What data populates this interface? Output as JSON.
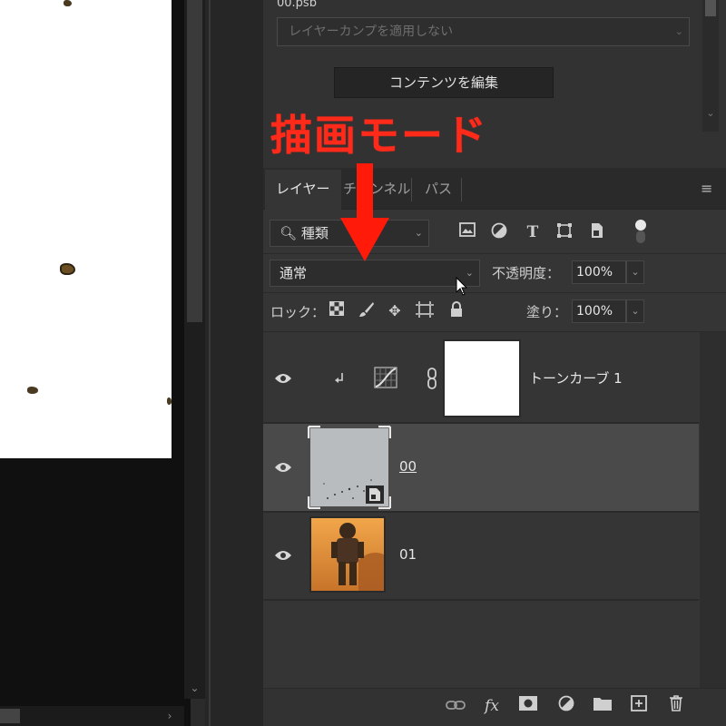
{
  "properties": {
    "filename": "00.psb",
    "layer_comp_placeholder": "レイヤーカンプを適用しない",
    "edit_contents_label": "コンテンツを編集"
  },
  "annotation": {
    "label": "描画モード",
    "color": "#ff2a1a"
  },
  "layers_panel": {
    "tabs": [
      {
        "label": "レイヤー",
        "active": true
      },
      {
        "label": "チャンネル",
        "active": false
      },
      {
        "label": "パス",
        "active": false
      }
    ],
    "filter_value": "種類",
    "filter_icons": [
      "image-filter-icon",
      "adjustment-filter-icon",
      "type-filter-icon",
      "shape-filter-icon",
      "smart-object-filter-icon"
    ],
    "blend_mode": "通常",
    "opacity_label": "不透明度：",
    "opacity_value": "100%",
    "lock_label": "ロック：",
    "fill_label": "塗り：",
    "fill_value": "100%",
    "layers": [
      {
        "name": "トーンカーブ 1",
        "visible": true,
        "type": "adjustment",
        "clipped": true
      },
      {
        "name": "00",
        "visible": true,
        "type": "smart-object",
        "selected": true
      },
      {
        "name": "01",
        "visible": true,
        "type": "image"
      }
    ],
    "bottom_icons": [
      "link-layers-icon",
      "fx-icon",
      "add-mask-icon",
      "new-adjustment-icon",
      "new-group-icon",
      "new-layer-icon",
      "delete-layer-icon"
    ]
  },
  "colors": {
    "panel_bg": "#353535",
    "selected_row": "#4a4a4a",
    "annotation_red": "#ff1a0a"
  }
}
